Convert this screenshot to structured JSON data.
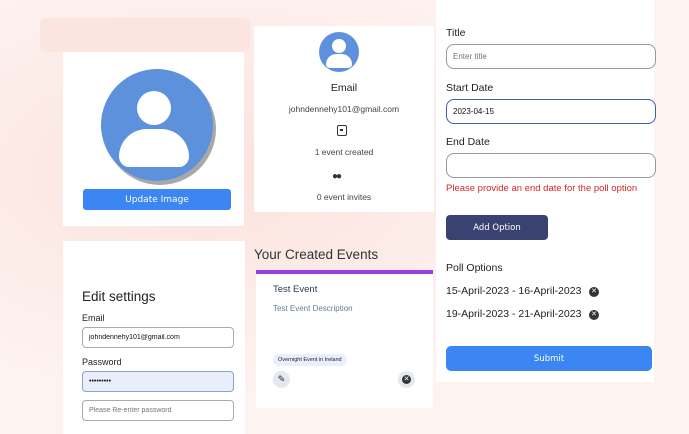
{
  "avatar_card": {
    "update_image_label": "Update Image"
  },
  "profile": {
    "email_label": "Email",
    "email": "johndennehy101@gmail.com",
    "events_created": "1 event created",
    "event_invites": "0 event invites"
  },
  "settings": {
    "title": "Edit settings",
    "email_label": "Email",
    "email_value": "johndennehy101@gmail.com",
    "password_label": "Password",
    "password_value": "•••••••••",
    "reenter_placeholder": "Please Re-enter password"
  },
  "events": {
    "title": "Your Created Events",
    "items": [
      {
        "title": "Test Event",
        "description": "Test Event Description",
        "badge": "Overnight Event in Ireland"
      }
    ]
  },
  "poll_form": {
    "title_label": "Title",
    "title_placeholder": "Enter title",
    "start_label": "Start Date",
    "start_value": "2023-04-15",
    "end_label": "End Date",
    "end_value": "",
    "error": "Please provide an end date for the poll option",
    "add_option_label": "Add Option",
    "options_label": "Poll Options",
    "options": [
      "15-April-2023 - 16-April-2023",
      "19-April-2023 - 21-April-2023"
    ],
    "submit_label": "Submit"
  },
  "colors": {
    "primary_button": "#3b86f3",
    "add_option_button": "#3a4272",
    "error_text": "#d52626",
    "events_accent": "#9d3ee0",
    "avatar": "#5d91dc"
  }
}
